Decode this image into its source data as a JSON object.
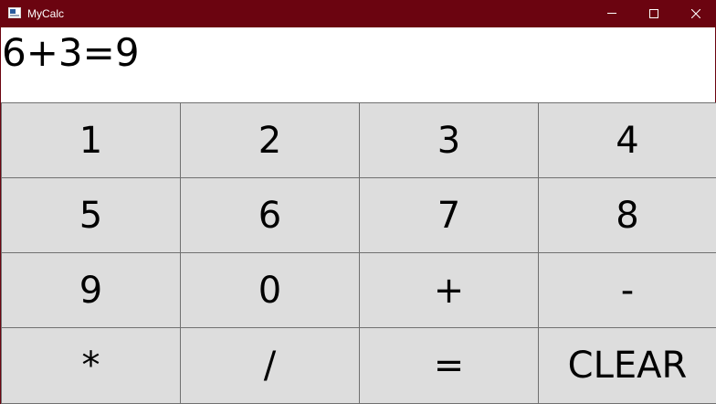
{
  "window": {
    "title": "MyCalc",
    "titlebar_color": "#6b0410",
    "controls": [
      "minimize-icon",
      "maximize-icon",
      "close-icon"
    ]
  },
  "display": {
    "text": "6+3=9"
  },
  "keypad": {
    "button_color": "#dddddd",
    "rows": [
      [
        "1",
        "2",
        "3",
        "4"
      ],
      [
        "5",
        "6",
        "7",
        "8"
      ],
      [
        "9",
        "0",
        "+",
        "-"
      ],
      [
        "*",
        "/",
        "=",
        "CLEAR"
      ]
    ]
  }
}
